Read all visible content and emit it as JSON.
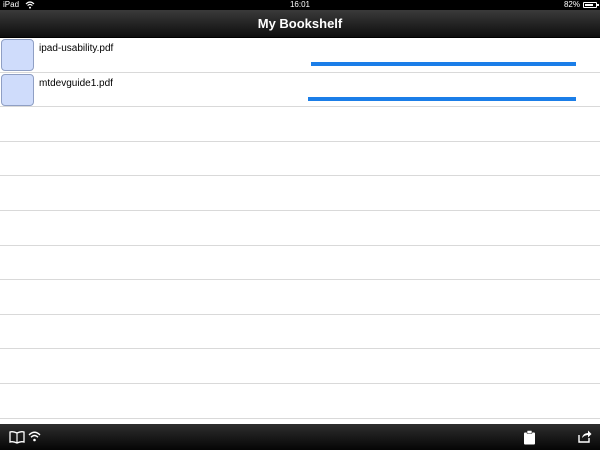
{
  "status_bar": {
    "device": "iPad",
    "time": "16:01",
    "battery_pct": "82%",
    "battery_level": 0.82
  },
  "nav": {
    "title": "My Bookshelf"
  },
  "files": [
    {
      "name": "ipad-usability.pdf",
      "progress": 0.99
    },
    {
      "name": "mtdevguide1.pdf",
      "progress": 1.0
    }
  ],
  "empty_rows": 9,
  "toolbar": {
    "icons": [
      "library-icon",
      "wifi-icon",
      "clipboard-icon",
      "share-icon"
    ]
  },
  "colors": {
    "progress": "#1b7ee8",
    "thumb": "#cfdcfb"
  }
}
